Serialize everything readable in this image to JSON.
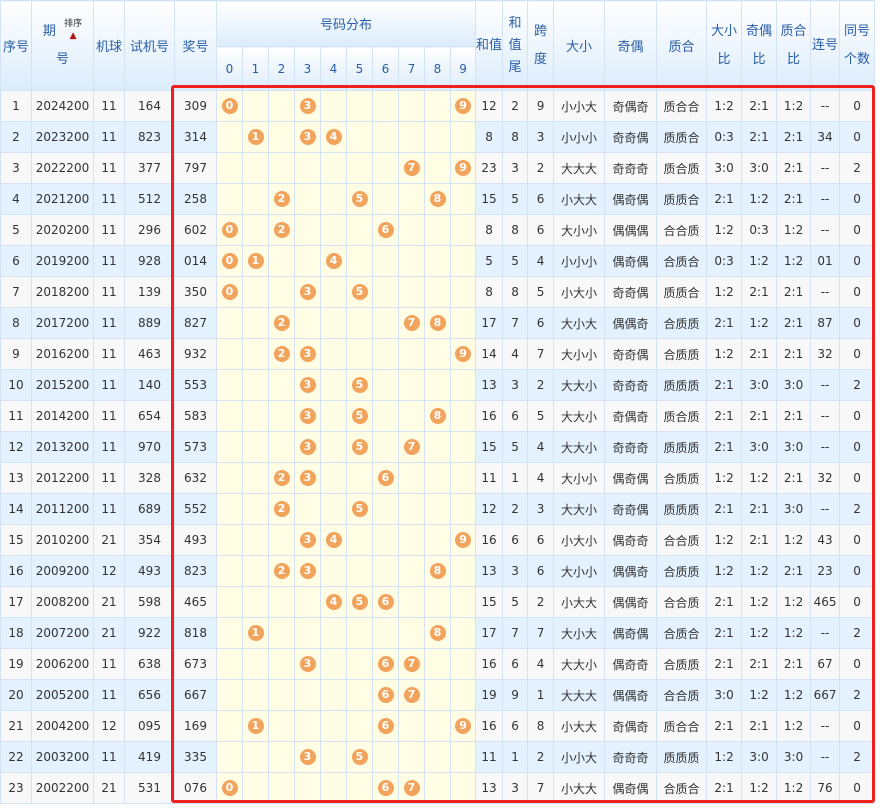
{
  "header": {
    "seq": "序号",
    "period": [
      "期",
      "号"
    ],
    "sort_label": "排序",
    "machine": "机球",
    "test_no": "试机号",
    "prize_no": "奖号",
    "distribution": "号码分布",
    "digits": [
      "0",
      "1",
      "2",
      "3",
      "4",
      "5",
      "6",
      "7",
      "8",
      "9"
    ],
    "sum": "和值",
    "sum_tail": "和值尾",
    "span": "跨度",
    "big_small": "大小",
    "odd_even": "奇偶",
    "prime_comp": "质合",
    "bs_ratio": "大小比",
    "oe_ratio": "奇偶比",
    "pc_ratio": "质合比",
    "consec": "连号",
    "same_count": "同号个数"
  },
  "accent": {
    "ball": "#f2a35c",
    "highlight_box": "#f0201c"
  },
  "rows": [
    [
      "1",
      "2024200",
      "11",
      "164",
      "309",
      "12",
      "2",
      "9",
      "小小大",
      "奇偶奇",
      "质合合",
      "1:2",
      "2:1",
      "1:2",
      "--",
      "0"
    ],
    [
      "2",
      "2023200",
      "11",
      "823",
      "314",
      "8",
      "8",
      "3",
      "小小小",
      "奇奇偶",
      "质质合",
      "0:3",
      "2:1",
      "2:1",
      "34",
      "0"
    ],
    [
      "3",
      "2022200",
      "11",
      "377",
      "797",
      "23",
      "3",
      "2",
      "大大大",
      "奇奇奇",
      "质合质",
      "3:0",
      "3:0",
      "2:1",
      "--",
      "2"
    ],
    [
      "4",
      "2021200",
      "11",
      "512",
      "258",
      "15",
      "5",
      "6",
      "小大大",
      "偶奇偶",
      "质质合",
      "2:1",
      "1:2",
      "2:1",
      "--",
      "0"
    ],
    [
      "5",
      "2020200",
      "11",
      "296",
      "602",
      "8",
      "8",
      "6",
      "大小小",
      "偶偶偶",
      "合合质",
      "1:2",
      "0:3",
      "1:2",
      "--",
      "0"
    ],
    [
      "6",
      "2019200",
      "11",
      "928",
      "014",
      "5",
      "5",
      "4",
      "小小小",
      "偶奇偶",
      "合质合",
      "0:3",
      "1:2",
      "1:2",
      "01",
      "0"
    ],
    [
      "7",
      "2018200",
      "11",
      "139",
      "350",
      "8",
      "8",
      "5",
      "小大小",
      "奇奇偶",
      "质质合",
      "1:2",
      "2:1",
      "2:1",
      "--",
      "0"
    ],
    [
      "8",
      "2017200",
      "11",
      "889",
      "827",
      "17",
      "7",
      "6",
      "大小大",
      "偶偶奇",
      "合质质",
      "2:1",
      "1:2",
      "2:1",
      "87",
      "0"
    ],
    [
      "9",
      "2016200",
      "11",
      "463",
      "932",
      "14",
      "4",
      "7",
      "大小小",
      "奇奇偶",
      "合质质",
      "1:2",
      "2:1",
      "2:1",
      "32",
      "0"
    ],
    [
      "10",
      "2015200",
      "11",
      "140",
      "553",
      "13",
      "3",
      "2",
      "大大小",
      "奇奇奇",
      "质质质",
      "2:1",
      "3:0",
      "3:0",
      "--",
      "2"
    ],
    [
      "11",
      "2014200",
      "11",
      "654",
      "583",
      "16",
      "6",
      "5",
      "大大小",
      "奇偶奇",
      "质合质",
      "2:1",
      "2:1",
      "2:1",
      "--",
      "0"
    ],
    [
      "12",
      "2013200",
      "11",
      "970",
      "573",
      "15",
      "5",
      "4",
      "大大小",
      "奇奇奇",
      "质质质",
      "2:1",
      "3:0",
      "3:0",
      "--",
      "0"
    ],
    [
      "13",
      "2012200",
      "11",
      "328",
      "632",
      "11",
      "1",
      "4",
      "大小小",
      "偶奇偶",
      "合质质",
      "1:2",
      "1:2",
      "2:1",
      "32",
      "0"
    ],
    [
      "14",
      "2011200",
      "11",
      "689",
      "552",
      "12",
      "2",
      "3",
      "大大小",
      "奇奇偶",
      "质质质",
      "2:1",
      "2:1",
      "3:0",
      "--",
      "2"
    ],
    [
      "15",
      "2010200",
      "21",
      "354",
      "493",
      "16",
      "6",
      "6",
      "小大小",
      "偶奇奇",
      "合合质",
      "1:2",
      "2:1",
      "1:2",
      "43",
      "0"
    ],
    [
      "16",
      "2009200",
      "12",
      "493",
      "823",
      "13",
      "3",
      "6",
      "大小小",
      "偶偶奇",
      "合质质",
      "1:2",
      "1:2",
      "2:1",
      "23",
      "0"
    ],
    [
      "17",
      "2008200",
      "21",
      "598",
      "465",
      "15",
      "5",
      "2",
      "小大大",
      "偶偶奇",
      "合合质",
      "2:1",
      "1:2",
      "1:2",
      "465",
      "0"
    ],
    [
      "18",
      "2007200",
      "21",
      "922",
      "818",
      "17",
      "7",
      "7",
      "大小大",
      "偶奇偶",
      "合质合",
      "2:1",
      "1:2",
      "1:2",
      "--",
      "2"
    ],
    [
      "19",
      "2006200",
      "11",
      "638",
      "673",
      "16",
      "6",
      "4",
      "大大小",
      "偶奇奇",
      "合质质",
      "2:1",
      "2:1",
      "2:1",
      "67",
      "0"
    ],
    [
      "20",
      "2005200",
      "11",
      "656",
      "667",
      "19",
      "9",
      "1",
      "大大大",
      "偶偶奇",
      "合合质",
      "3:0",
      "1:2",
      "1:2",
      "667",
      "2"
    ],
    [
      "21",
      "2004200",
      "12",
      "095",
      "169",
      "16",
      "6",
      "8",
      "小大大",
      "奇偶奇",
      "质合合",
      "2:1",
      "2:1",
      "1:2",
      "--",
      "0"
    ],
    [
      "22",
      "2003200",
      "11",
      "419",
      "335",
      "11",
      "1",
      "2",
      "小小大",
      "奇奇奇",
      "质质质",
      "1:2",
      "3:0",
      "3:0",
      "--",
      "2"
    ],
    [
      "23",
      "2002200",
      "21",
      "531",
      "076",
      "13",
      "3",
      "7",
      "小大大",
      "偶奇偶",
      "合质合",
      "2:1",
      "1:2",
      "1:2",
      "76",
      "0"
    ]
  ]
}
